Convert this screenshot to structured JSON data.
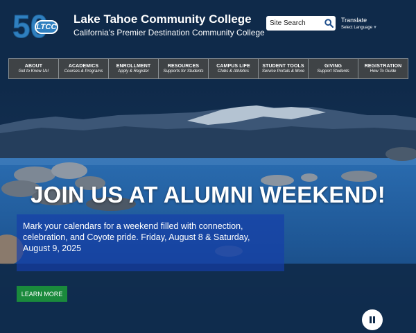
{
  "header": {
    "logo": {
      "number": "50",
      "badge": "LTCC"
    },
    "college_name": "Lake Tahoe Community College",
    "tagline": "California's Premier Destination Community College",
    "search": {
      "placeholder": "Site Search"
    },
    "translate": {
      "label": "Translate",
      "select_label": "Select Language"
    }
  },
  "nav": {
    "items": [
      {
        "label": "ABOUT",
        "sub": "Get to Know Us!"
      },
      {
        "label": "ACADEMICS",
        "sub": "Courses & Programs"
      },
      {
        "label": "ENROLLMENT",
        "sub": "Apply & Register"
      },
      {
        "label": "RESOURCES",
        "sub": "Supports for Students"
      },
      {
        "label": "CAMPUS LIFE",
        "sub": "Clubs & Athletics"
      },
      {
        "label": "STUDENT TOOLS",
        "sub": "Service Portals & More"
      },
      {
        "label": "GIVING",
        "sub": "Support Students"
      },
      {
        "label": "REGISTRATION",
        "sub": "How To Guide"
      }
    ]
  },
  "hero": {
    "title": "JOIN US AT ALUMNI WEEKEND!",
    "text": "Mark your calendars for a weekend filled with connection, celebration, and Coyote pride. Friday, August 8 & Saturday, August 9, 2025",
    "button_label": "LEARN MORE"
  },
  "colors": {
    "header_bg": "#0f2a4a",
    "nav_bg": "#3f4346",
    "logo_blue": "#2f7fbf",
    "button_green": "#1a8a3c",
    "panel_blue": "#143eaa"
  },
  "icons": {
    "search": "search-icon",
    "dropdown": "dropdown-arrow-icon",
    "pause": "pause-icon"
  }
}
